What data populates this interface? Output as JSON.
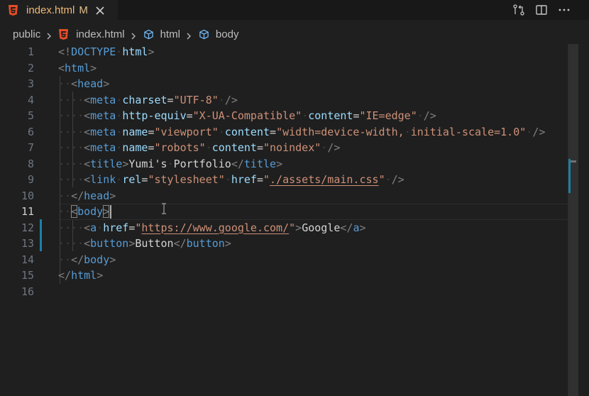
{
  "tab": {
    "filename": "index.html",
    "status": "M",
    "icon": "html5-icon"
  },
  "toolbar": {
    "actions": [
      "source-control-diff-icon",
      "split-editor-icon",
      "more-actions-icon"
    ]
  },
  "breadcrumb": [
    {
      "label": "public",
      "icon": ""
    },
    {
      "label": "index.html",
      "icon": "html5-icon"
    },
    {
      "label": "html",
      "icon": "symbol-element-icon"
    },
    {
      "label": "body",
      "icon": "symbol-element-icon"
    }
  ],
  "editor": {
    "active_line": 11,
    "lines": [
      {
        "n": "1",
        "tokens": [
          [
            "punc",
            "<!"
          ],
          [
            "tag",
            "DOCTYPE"
          ],
          [
            "ws",
            "·"
          ],
          [
            "attr",
            "html"
          ],
          [
            "punc",
            ">"
          ]
        ]
      },
      {
        "n": "2",
        "tokens": [
          [
            "punc",
            "<"
          ],
          [
            "tag",
            "html"
          ],
          [
            "punc",
            ">"
          ]
        ]
      },
      {
        "n": "3",
        "tokens": [
          [
            "ws",
            "··"
          ],
          [
            "punc",
            "<"
          ],
          [
            "tag",
            "head"
          ],
          [
            "punc",
            ">"
          ]
        ]
      },
      {
        "n": "4",
        "tokens": [
          [
            "ws",
            "····"
          ],
          [
            "punc",
            "<"
          ],
          [
            "tag",
            "meta"
          ],
          [
            "ws",
            "·"
          ],
          [
            "attr",
            "charset"
          ],
          [
            "txt",
            "="
          ],
          [
            "str",
            "\"UTF-8\""
          ],
          [
            "ws",
            "·"
          ],
          [
            "punc",
            "/>"
          ]
        ]
      },
      {
        "n": "5",
        "tokens": [
          [
            "ws",
            "····"
          ],
          [
            "punc",
            "<"
          ],
          [
            "tag",
            "meta"
          ],
          [
            "ws",
            "·"
          ],
          [
            "attr",
            "http-equiv"
          ],
          [
            "txt",
            "="
          ],
          [
            "str",
            "\"X-UA-Compatible\""
          ],
          [
            "ws",
            "·"
          ],
          [
            "attr",
            "content"
          ],
          [
            "txt",
            "="
          ],
          [
            "str",
            "\"IE=edge\""
          ],
          [
            "ws",
            "·"
          ],
          [
            "punc",
            "/>"
          ]
        ]
      },
      {
        "n": "6",
        "tokens": [
          [
            "ws",
            "····"
          ],
          [
            "punc",
            "<"
          ],
          [
            "tag",
            "meta"
          ],
          [
            "ws",
            "·"
          ],
          [
            "attr",
            "name"
          ],
          [
            "txt",
            "="
          ],
          [
            "str",
            "\"viewport\""
          ],
          [
            "ws",
            "·"
          ],
          [
            "attr",
            "content"
          ],
          [
            "txt",
            "="
          ],
          [
            "str",
            "\"width=device-width,"
          ],
          [
            "ws",
            "·"
          ],
          [
            "str",
            "initial-scale=1.0\""
          ],
          [
            "ws",
            "·"
          ],
          [
            "punc",
            "/>"
          ]
        ]
      },
      {
        "n": "7",
        "tokens": [
          [
            "ws",
            "····"
          ],
          [
            "punc",
            "<"
          ],
          [
            "tag",
            "meta"
          ],
          [
            "ws",
            "·"
          ],
          [
            "attr",
            "name"
          ],
          [
            "txt",
            "="
          ],
          [
            "str",
            "\"robots\""
          ],
          [
            "ws",
            "·"
          ],
          [
            "attr",
            "content"
          ],
          [
            "txt",
            "="
          ],
          [
            "str",
            "\"noindex\""
          ],
          [
            "ws",
            "·"
          ],
          [
            "punc",
            "/>"
          ]
        ]
      },
      {
        "n": "8",
        "tokens": [
          [
            "ws",
            "····"
          ],
          [
            "punc",
            "<"
          ],
          [
            "tag",
            "title"
          ],
          [
            "punc",
            ">"
          ],
          [
            "txt",
            "Yumi's"
          ],
          [
            "ws",
            "·"
          ],
          [
            "txt",
            "Portfolio"
          ],
          [
            "punc",
            "</"
          ],
          [
            "tag",
            "title"
          ],
          [
            "punc",
            ">"
          ]
        ]
      },
      {
        "n": "9",
        "tokens": [
          [
            "ws",
            "····"
          ],
          [
            "punc",
            "<"
          ],
          [
            "tag",
            "link"
          ],
          [
            "ws",
            "·"
          ],
          [
            "attr",
            "rel"
          ],
          [
            "txt",
            "="
          ],
          [
            "str",
            "\"stylesheet\""
          ],
          [
            "ws",
            "·"
          ],
          [
            "attr",
            "href"
          ],
          [
            "txt",
            "="
          ],
          [
            "str",
            "\""
          ],
          [
            "strlink",
            "./assets/main.css"
          ],
          [
            "str",
            "\""
          ],
          [
            "ws",
            "·"
          ],
          [
            "punc",
            "/>"
          ]
        ]
      },
      {
        "n": "10",
        "tokens": [
          [
            "ws",
            "··"
          ],
          [
            "punc",
            "</"
          ],
          [
            "tag",
            "head"
          ],
          [
            "punc",
            ">"
          ]
        ]
      },
      {
        "n": "11",
        "tokens": [
          [
            "ws",
            "··"
          ],
          [
            "punc",
            "<"
          ],
          [
            "tag",
            "body"
          ],
          [
            "punc",
            ">"
          ]
        ]
      },
      {
        "n": "12",
        "tokens": [
          [
            "ws",
            "····"
          ],
          [
            "punc",
            "<"
          ],
          [
            "tag",
            "a"
          ],
          [
            "ws",
            "·"
          ],
          [
            "attr",
            "href"
          ],
          [
            "txt",
            "="
          ],
          [
            "str",
            "\""
          ],
          [
            "strlink",
            "https://www.google.com/"
          ],
          [
            "str",
            "\""
          ],
          [
            "punc",
            ">"
          ],
          [
            "txt",
            "Google"
          ],
          [
            "punc",
            "</"
          ],
          [
            "tag",
            "a"
          ],
          [
            "punc",
            ">"
          ]
        ]
      },
      {
        "n": "13",
        "tokens": [
          [
            "ws",
            "····"
          ],
          [
            "punc",
            "<"
          ],
          [
            "tag",
            "button"
          ],
          [
            "punc",
            ">"
          ],
          [
            "txt",
            "Button"
          ],
          [
            "punc",
            "</"
          ],
          [
            "tag",
            "button"
          ],
          [
            "punc",
            ">"
          ]
        ]
      },
      {
        "n": "14",
        "tokens": [
          [
            "ws",
            "··"
          ],
          [
            "punc",
            "</"
          ],
          [
            "tag",
            "body"
          ],
          [
            "punc",
            ">"
          ]
        ]
      },
      {
        "n": "15",
        "tokens": [
          [
            "punc",
            "</"
          ],
          [
            "tag",
            "html"
          ],
          [
            "punc",
            ">"
          ]
        ]
      },
      {
        "n": "16",
        "tokens": []
      }
    ]
  }
}
